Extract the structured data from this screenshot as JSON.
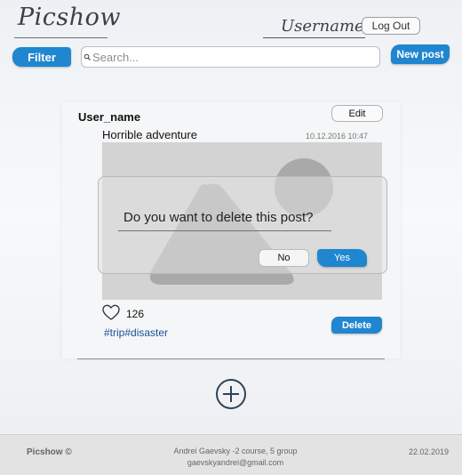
{
  "header": {
    "logo": "Picshow",
    "username": "Username",
    "logout_label": "Log Out"
  },
  "toolbar": {
    "filter_label": "Filter",
    "search_placeholder": "Search...",
    "new_post_label": "New post"
  },
  "post": {
    "author": "User_name",
    "edit_label": "Edit",
    "title": "Horrible adventure",
    "date": "10.12.2016 10:47",
    "likes": "126",
    "tags": "#trip#disaster",
    "delete_label": "Delete"
  },
  "modal": {
    "question": "Do you want to delete this post?",
    "no_label": "No",
    "yes_label": "Yes"
  },
  "footer": {
    "brand": "Picshow ©",
    "author_line": "Andrei Gaevsky -2 course, 5 group",
    "email": "gaevskyandrei@gmail.com",
    "date": "22.02.2019"
  },
  "colors": {
    "accent": "#1f86cf",
    "tag_link": "#1a4f99"
  }
}
